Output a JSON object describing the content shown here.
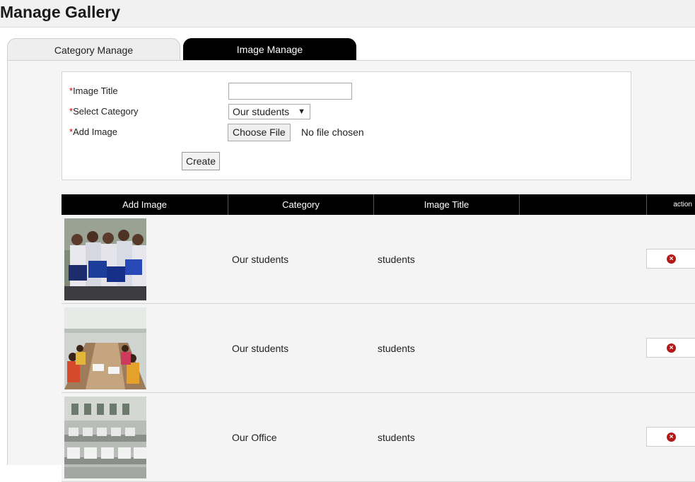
{
  "page": {
    "title": "Manage Gallery"
  },
  "tabs": [
    {
      "label": "Category Manage"
    },
    {
      "label": "Image Manage"
    }
  ],
  "form": {
    "title_label": "Image Title",
    "category_label": "Select Category",
    "image_label": "Add Image",
    "required_mark": "*",
    "title_value": "",
    "category_selected": "Our students",
    "category_arrow": "▼",
    "file_button": "Choose File",
    "file_status": "No file chosen",
    "create_button": "Create"
  },
  "table": {
    "headers": [
      "Add Image",
      "Category",
      "Image Title",
      "",
      "action"
    ],
    "rows": [
      {
        "category": "Our students",
        "title": "students",
        "thumbnail": "students-with-laptops-photo"
      },
      {
        "category": "Our students",
        "title": "students",
        "thumbnail": "students-at-tables-photo"
      },
      {
        "category": "Our Office",
        "title": "students",
        "thumbnail": "computer-lab-photo"
      }
    ],
    "delete_icon": "×"
  },
  "colors": {
    "header_bar": "#000000",
    "active_tab": "#000000",
    "required": "#cc0000",
    "delete_icon": "#b31919"
  }
}
